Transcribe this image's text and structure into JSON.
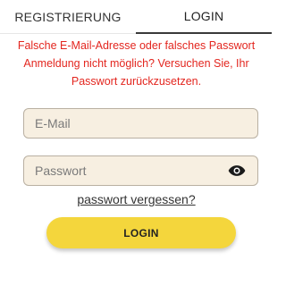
{
  "tabs": [
    {
      "label": "REGISTRIERUNG",
      "active": false
    },
    {
      "label": "LOGIN",
      "active": true
    }
  ],
  "error": {
    "line1": "Falsche E-Mail-Adresse oder falsches Passwort",
    "line2": "Anmeldung nicht möglich? Versuchen Sie, Ihr Passwort zurückzusetzen."
  },
  "form": {
    "email": {
      "value": "",
      "placeholder": "E-Mail"
    },
    "password": {
      "value": "",
      "placeholder": "Passwort",
      "toggle_icon": "eye-icon"
    },
    "forgot_label": "passwort vergessen?",
    "submit_label": "LOGIN"
  },
  "colors": {
    "error": "#e3261f",
    "accent_button": "#f4d63c",
    "field_background": "#f7efe1"
  }
}
